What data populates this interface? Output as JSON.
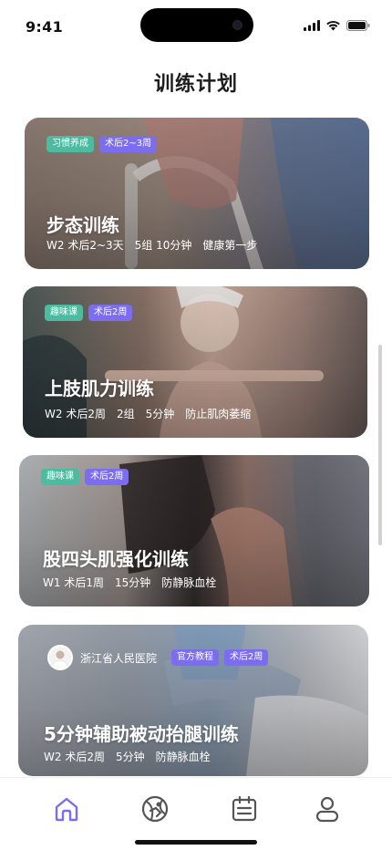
{
  "status_bar": {
    "time": "9:41"
  },
  "page": {
    "title": "训练计划"
  },
  "cards": [
    {
      "tags": [
        "习惯养成",
        "术后2~3周"
      ],
      "title": "步态训练",
      "meta": [
        "W2 术后2~3天",
        "5组 10分钟",
        "健康第一步"
      ]
    },
    {
      "tags": [
        "趣味课",
        "术后2周"
      ],
      "title": "上肢肌力训练",
      "meta": [
        "W2 术后2周",
        "2组",
        "5分钟",
        "防止肌肉萎缩"
      ]
    },
    {
      "tags": [
        "趣味课",
        "术后2周"
      ],
      "title": "股四头肌强化训练",
      "meta": [
        "W1 术后1周",
        "15分钟",
        "防静脉血栓"
      ]
    },
    {
      "hospital": "浙江省人民医院",
      "tags": [
        "官方教程",
        "术后2周"
      ],
      "title": "5分钟辅助被动抬腿训练",
      "meta": [
        "W2 术后2周",
        "5分钟",
        "防静脉血栓"
      ]
    }
  ],
  "tab_bar": {
    "items": [
      {
        "icon": "home-icon",
        "active": true
      },
      {
        "icon": "sport-ball-icon",
        "active": false
      },
      {
        "icon": "calendar-icon",
        "active": false
      },
      {
        "icon": "profile-icon",
        "active": false
      }
    ]
  },
  "colors": {
    "accent": "#7c6cf0",
    "tag_green": "#4cbba0",
    "tag_purple": "#7c6cf0",
    "icon_inactive": "#555555"
  }
}
